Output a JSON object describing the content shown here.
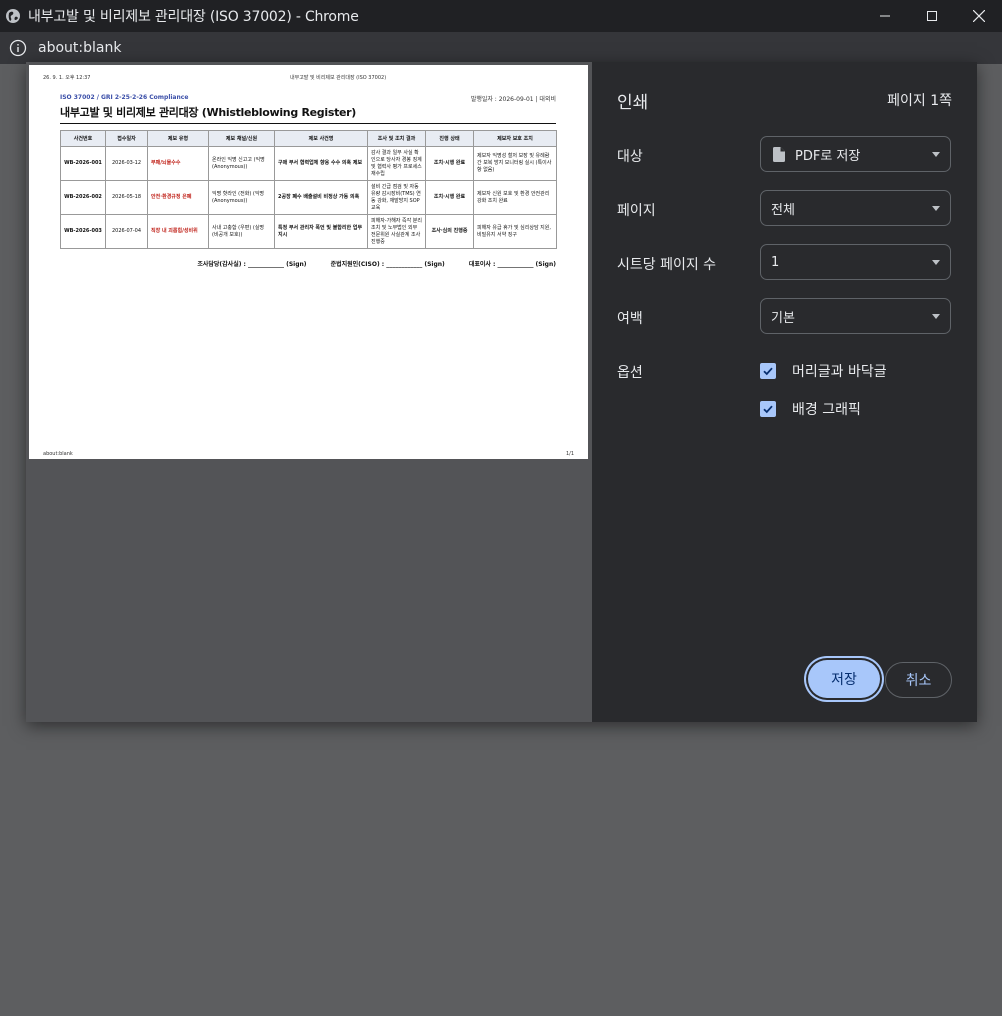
{
  "window": {
    "title": "내부고발 및 비리제보 관리대장 (ISO 37002) - Chrome",
    "url": "about:blank"
  },
  "preview": {
    "header_left": "26. 9. 1. 오후 12:37",
    "header_center": "내부고발 및 비리제보 관리대장 (ISO 37002)",
    "footer_left": "about:blank",
    "footer_right": "1/1",
    "standard": "ISO 37002 / GRI 2-25·2-26 Compliance",
    "issue": "발행일자 : 2026-09-01 | 대외비",
    "title": "내부고발 및 비리제보 관리대장 (Whistleblowing Register)",
    "columns": [
      "사건번호",
      "접수일자",
      "제보 유형",
      "제보 채널/신원",
      "제보 사건명",
      "조사 및 조치 결과",
      "진행 상태",
      "제보자 보호 조치"
    ],
    "rows": [
      {
        "id": "WB-2026-001",
        "date": "2026-03-12",
        "type": "부패/뇌물수수",
        "channel": "온라인 익명 신고고 (익명 (Anonymous))",
        "subject": "구매 부서 협력업체 향응 수수 의혹 제보",
        "result": "감사 결과 일부 사실 확인으로 당사자 경봉 징계 및 협력사 평가 프로세스 재수립",
        "status": "조치·시행 완료",
        "protection": "제보자 익명성 철저 보장 및 유례람 간 보복 방지 모니터링 실시 (특이사항 없음)"
      },
      {
        "id": "WB-2026-002",
        "date": "2026-05-18",
        "type": "안전·환경규정 은폐",
        "channel": "익명 핫라인 (전화) (익명 (Anonymous))",
        "subject": "2공장 폐수 배출설비 비정상 가동 의혹",
        "result": "설비 긴급 점검 및 자동 유량 감시장비(TMS) 연동 강화, 재발방지 SOP 교육",
        "status": "조치·시행 완료",
        "protection": "제보자 신원 보호 및 환경 안전관리 강화 조치 완료"
      },
      {
        "id": "WB-2026-003",
        "date": "2026-07-04",
        "type": "직장 내 괴롭힘/성비위",
        "channel": "사내 고충함 (우편) (실명 (비공개 보호))",
        "subject": "특정 부서 관리자 폭언 및 불합리한 업무 지시",
        "result": "피해자-가해자 즉각 분리 조치 및 노무법인 외부 전문위원 사실관계 조사 진행중",
        "status": "조사·심의 진행중",
        "protection": "피해자 유급 휴가 및 심리상담 지원, 비밀유지 서약 징구"
      }
    ],
    "signs": [
      "조사담당(감사실) : ____________ (Sign)",
      "준법지원인(CISO) : ____________ (Sign)",
      "대표이사 : ____________ (Sign)"
    ]
  },
  "panel": {
    "heading": "인쇄",
    "pages_count": "페이지 1쪽",
    "destination_label": "대상",
    "destination_value": "PDF로 저장",
    "pages_label": "페이지",
    "pages_value": "전체",
    "per_sheet_label": "시트당 페이지 수",
    "per_sheet_value": "1",
    "margins_label": "여백",
    "margins_value": "기본",
    "options_label": "옵션",
    "option_headers": "머리글과 바닥글",
    "option_background": "배경 그래픽",
    "save": "저장",
    "cancel": "취소"
  },
  "colors": {
    "accent": "#a8c7fa",
    "panel_bg": "#292a2d",
    "type_red": "#c0221a",
    "standard_blue": "#3a4ea8"
  }
}
